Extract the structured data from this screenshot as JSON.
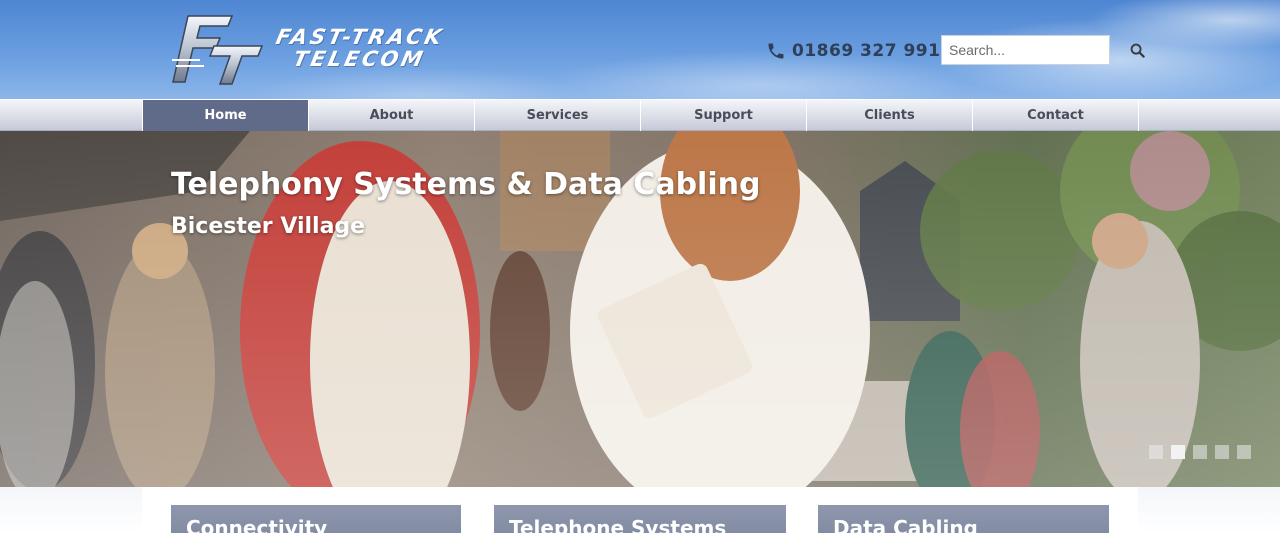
{
  "brand": {
    "logo_monogram": "FT",
    "name_line1": "FAST-TRACK",
    "name_line2": "TELECOM"
  },
  "contact": {
    "phone_icon": "phone-icon",
    "phone_number": "01869 327 991"
  },
  "search": {
    "placeholder": "Search...",
    "button_icon": "search-icon"
  },
  "nav": {
    "items": [
      {
        "label": "Home",
        "active": true
      },
      {
        "label": "About"
      },
      {
        "label": "Services"
      },
      {
        "label": "Support"
      },
      {
        "label": "Clients"
      },
      {
        "label": "Contact"
      }
    ]
  },
  "hero": {
    "title": "Telephony Systems & Data Cabling",
    "subtitle": "Bicester Village",
    "slide_count": 5,
    "active_slide": 2
  },
  "panels": [
    {
      "title": "Connectivity"
    },
    {
      "title": "Telephone Systems"
    },
    {
      "title": "Data Cabling"
    }
  ],
  "colors": {
    "nav_active": "#5f6b89",
    "panel_header": "#8690a7",
    "sky": "#5f92d8"
  }
}
